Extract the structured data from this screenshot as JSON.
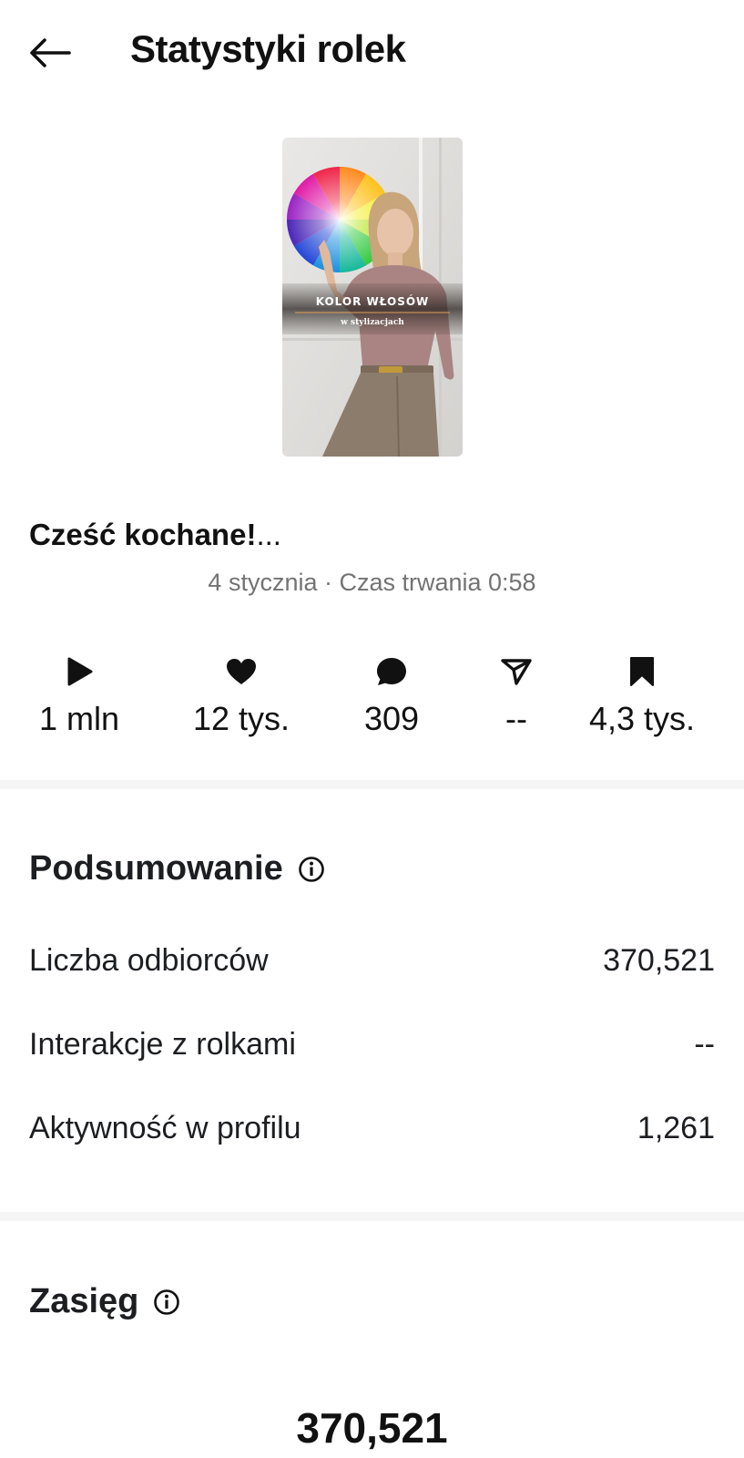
{
  "header": {
    "title": "Statystyki rolek"
  },
  "post": {
    "overlay_title": "KOLOR WŁOSÓW",
    "overlay_subtitle": "w stylizacjach",
    "caption": "Cześć kochane!",
    "caption_ellipsis": "...",
    "meta": "4 stycznia · Czas trwania 0:58"
  },
  "stats": [
    {
      "icon": "play-icon",
      "value": "1 mln"
    },
    {
      "icon": "heart-icon",
      "value": "12 tys."
    },
    {
      "icon": "comment-icon",
      "value": "309"
    },
    {
      "icon": "share-icon",
      "value": "--"
    },
    {
      "icon": "bookmark-icon",
      "value": "4,3 tys."
    }
  ],
  "summary": {
    "title": "Podsumowanie",
    "rows": [
      {
        "label": "Liczba odbiorców",
        "value": "370,521"
      },
      {
        "label": "Interakcje z rolkami",
        "value": "--"
      },
      {
        "label": "Aktywność w profilu",
        "value": "1,261"
      }
    ]
  },
  "reach": {
    "title": "Zasięg",
    "value": "370,521"
  },
  "colors": {
    "text": "#1c1e21",
    "secondary_text": "#737373",
    "separator": "#f5f5f5"
  }
}
